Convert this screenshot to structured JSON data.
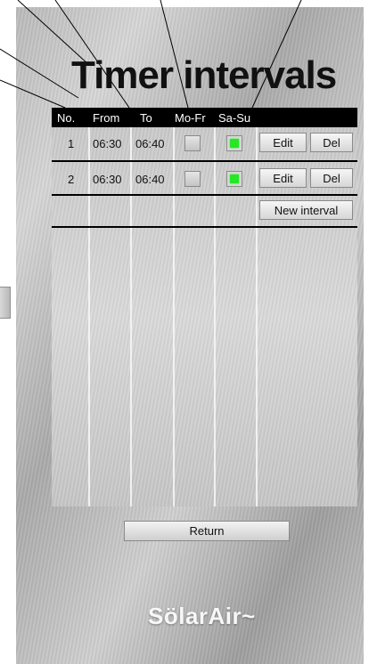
{
  "title": "Timer intervals",
  "columns": [
    "No.",
    "From",
    "To",
    "Mo-Fr",
    "Sa-Su"
  ],
  "rows": [
    {
      "no": "1",
      "from": "06:30",
      "to": "06:40",
      "mofr": false,
      "sasu": true,
      "edit_label": "Edit",
      "del_label": "Del"
    },
    {
      "no": "2",
      "from": "06:30",
      "to": "06:40",
      "mofr": false,
      "sasu": true,
      "edit_label": "Edit",
      "del_label": "Del"
    }
  ],
  "new_interval_label": "New interval",
  "return_label": "Return",
  "logo_text": "SölarAir~",
  "colors": {
    "header_bg": "#000000",
    "checkbox_on": "#26e626",
    "panel": "#c2c2c2"
  },
  "icons": [
    "checkbox-off-icon",
    "checkbox-on-icon"
  ]
}
